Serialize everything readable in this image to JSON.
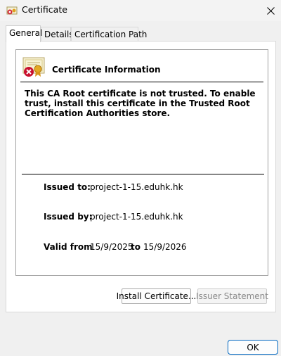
{
  "window": {
    "title": "Certificate"
  },
  "tabs": [
    {
      "label": "General",
      "active": true
    },
    {
      "label": "Details",
      "active": false
    },
    {
      "label": "Certification Path",
      "active": false
    }
  ],
  "info": {
    "heading": "Certificate Information",
    "warning": "This CA Root certificate is not trusted. To enable trust, install this certificate in the Trusted Root Certification Authorities store.",
    "issued_to_label": "Issued to:",
    "issued_to_value": "project-1-15.eduhk.hk",
    "issued_by_label": "Issued by:",
    "issued_by_value": "project-1-15.eduhk.hk",
    "valid_from_label": "Valid from",
    "valid_from_value": "15/9/2025",
    "valid_to_label": "to",
    "valid_to_value": "15/9/2026"
  },
  "buttons": {
    "install": "Install Certificate...",
    "issuer_statement": "Issuer Statement",
    "ok": "OK"
  },
  "icons": {
    "window": "certificate-icon",
    "close": "close-icon",
    "cert_status": "certificate-error-icon"
  },
  "colors": {
    "accent": "#0067c0",
    "error": "#c8102e"
  }
}
